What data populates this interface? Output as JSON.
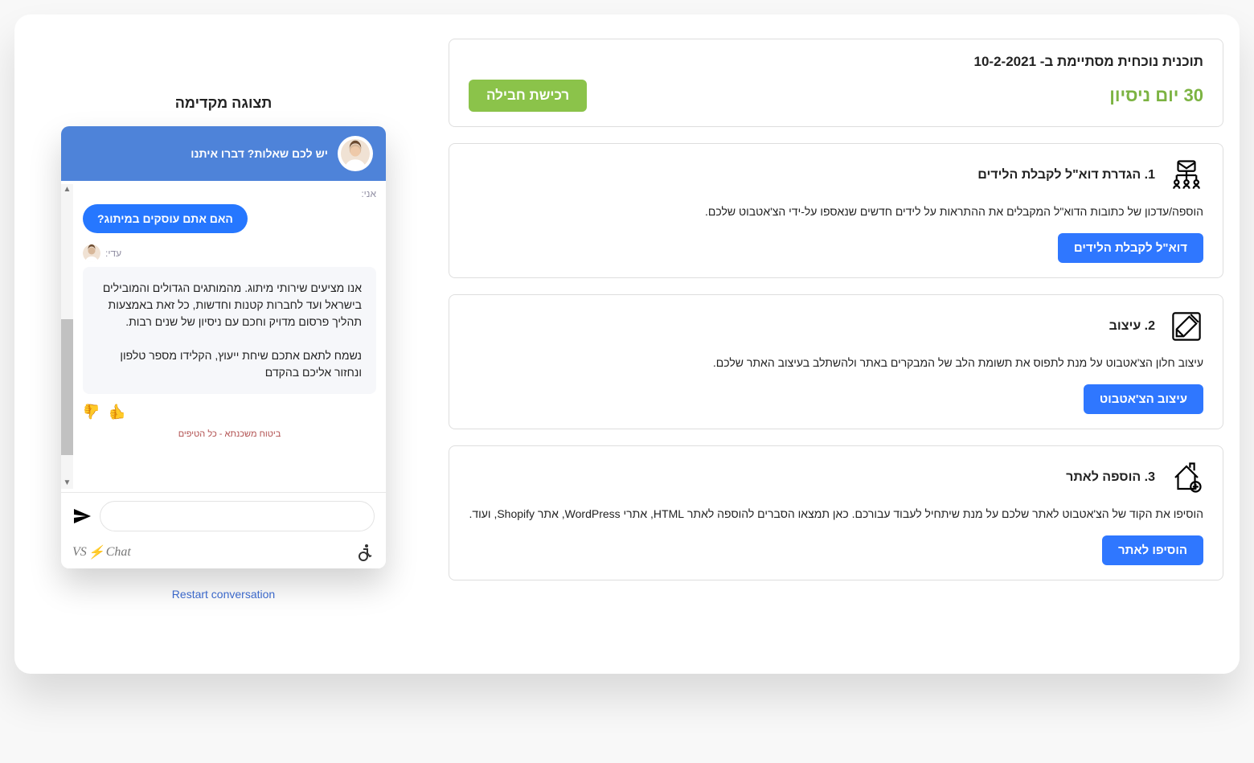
{
  "plan": {
    "headline": "תוכנית נוכחית מסתיימת ב- 10-2-2021",
    "trial": "30 יום ניסיון",
    "purchase_btn": "רכישת חבילה"
  },
  "steps": [
    {
      "title": "1. הגדרת דוא\"ל לקבלת הלידים",
      "desc": "הוספה/עדכון של כתובות הדוא\"ל המקבלים את ההתראות על לידים חדשים שנאספו על-ידי הצ'אטבוט שלכם.",
      "btn": "דוא\"ל לקבלת הלידים"
    },
    {
      "title": "2. עיצוב",
      "desc": "עיצוב חלון הצ'אטבוט על מנת לתפוס את תשומת הלב של המבקרים באתר ולהשתלב בעיצוב האתר שלכם.",
      "btn": "עיצוב הצ'אטבוט"
    },
    {
      "title": "3. הוספה לאתר",
      "desc": "הוסיפו את הקוד של הצ'אטבוט לאתר שלכם על מנת שיתחיל לעבוד עבורכם. כאן תמצאו הסברים להוספה לאתר HTML, אתרי WordPress, אתר Shopify, ועוד.",
      "btn": "הוסיפו לאתר"
    }
  ],
  "preview": {
    "title": "תצוגה מקדימה",
    "header": "יש לכם שאלות? דברו איתנו",
    "me_label": "אני:",
    "me_msg": "האם אתם עוסקים במיתוג?",
    "bot_name": "עדי:",
    "bot_msg": "אנו מציעים שירותי מיתוג. מהמותגים הגדולים והמובילים בישראל ועד לחברות קטנות וחדשות, כל זאת באמצעות תהליך פרסום מדויק וחכם עם ניסיון של שנים רבות.\n\nנשמח לתאם אתכם שיחת ייעוץ, הקלידו מספר טלפון ונחזור אליכם בהקדם",
    "cut_link": "ביטוח משכנתא - כל הטיפים",
    "chatvs_a": "Chat",
    "chatvs_b": "VS",
    "restart": "Restart conversation"
  }
}
